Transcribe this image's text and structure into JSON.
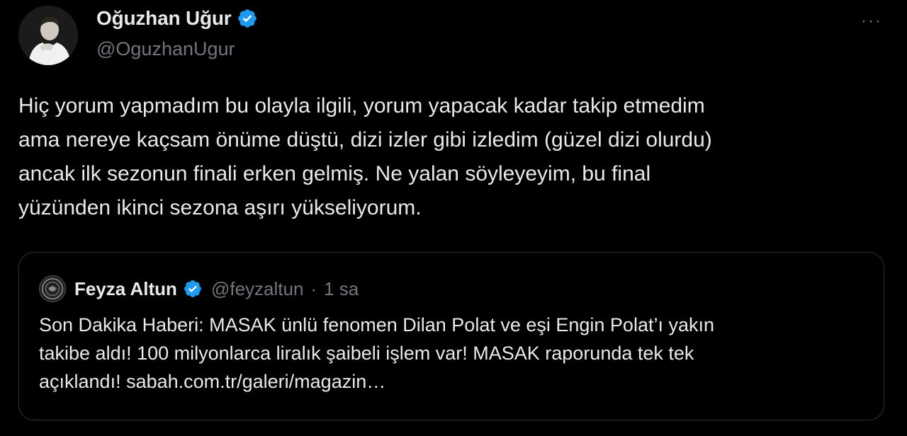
{
  "author": {
    "display_name": "Oğuzhan Uğur",
    "handle": "@OguzhanUgur",
    "verified_icon": "verified-badge-icon"
  },
  "menu": {
    "more_label": "···"
  },
  "tweet": {
    "lines": [
      "Hiç yorum yapmadım bu olayla ilgili, yorum yapacak kadar takip etmedim",
      "ama nereye kaçsam önüme düştü, dizi izler gibi izledim (güzel dizi olurdu)",
      "ancak ilk sezonun finali erken gelmiş. Ne yalan söyleyeyim, bu final",
      "yüzünden ikinci sezona aşırı yükseliyorum."
    ]
  },
  "quoted": {
    "display_name": "Feyza Altun",
    "handle": "@feyzaltun",
    "separator": "·",
    "time": "1 sa",
    "lines": [
      "Son Dakika Haberi: MASAK ünlü fenomen Dilan Polat ve eşi Engin Polat’ı yakın",
      "takibe aldı! 100 milyonlarca liralık şaibeli işlem var! MASAK raporunda tek tek",
      "açıklandı! sabah.com.tr/galeri/magazin…"
    ]
  },
  "colors": {
    "background": "#000000",
    "text": "#e7e9ea",
    "secondary": "#71767b",
    "border": "#2f3336",
    "verified": "#1d9bf0"
  }
}
